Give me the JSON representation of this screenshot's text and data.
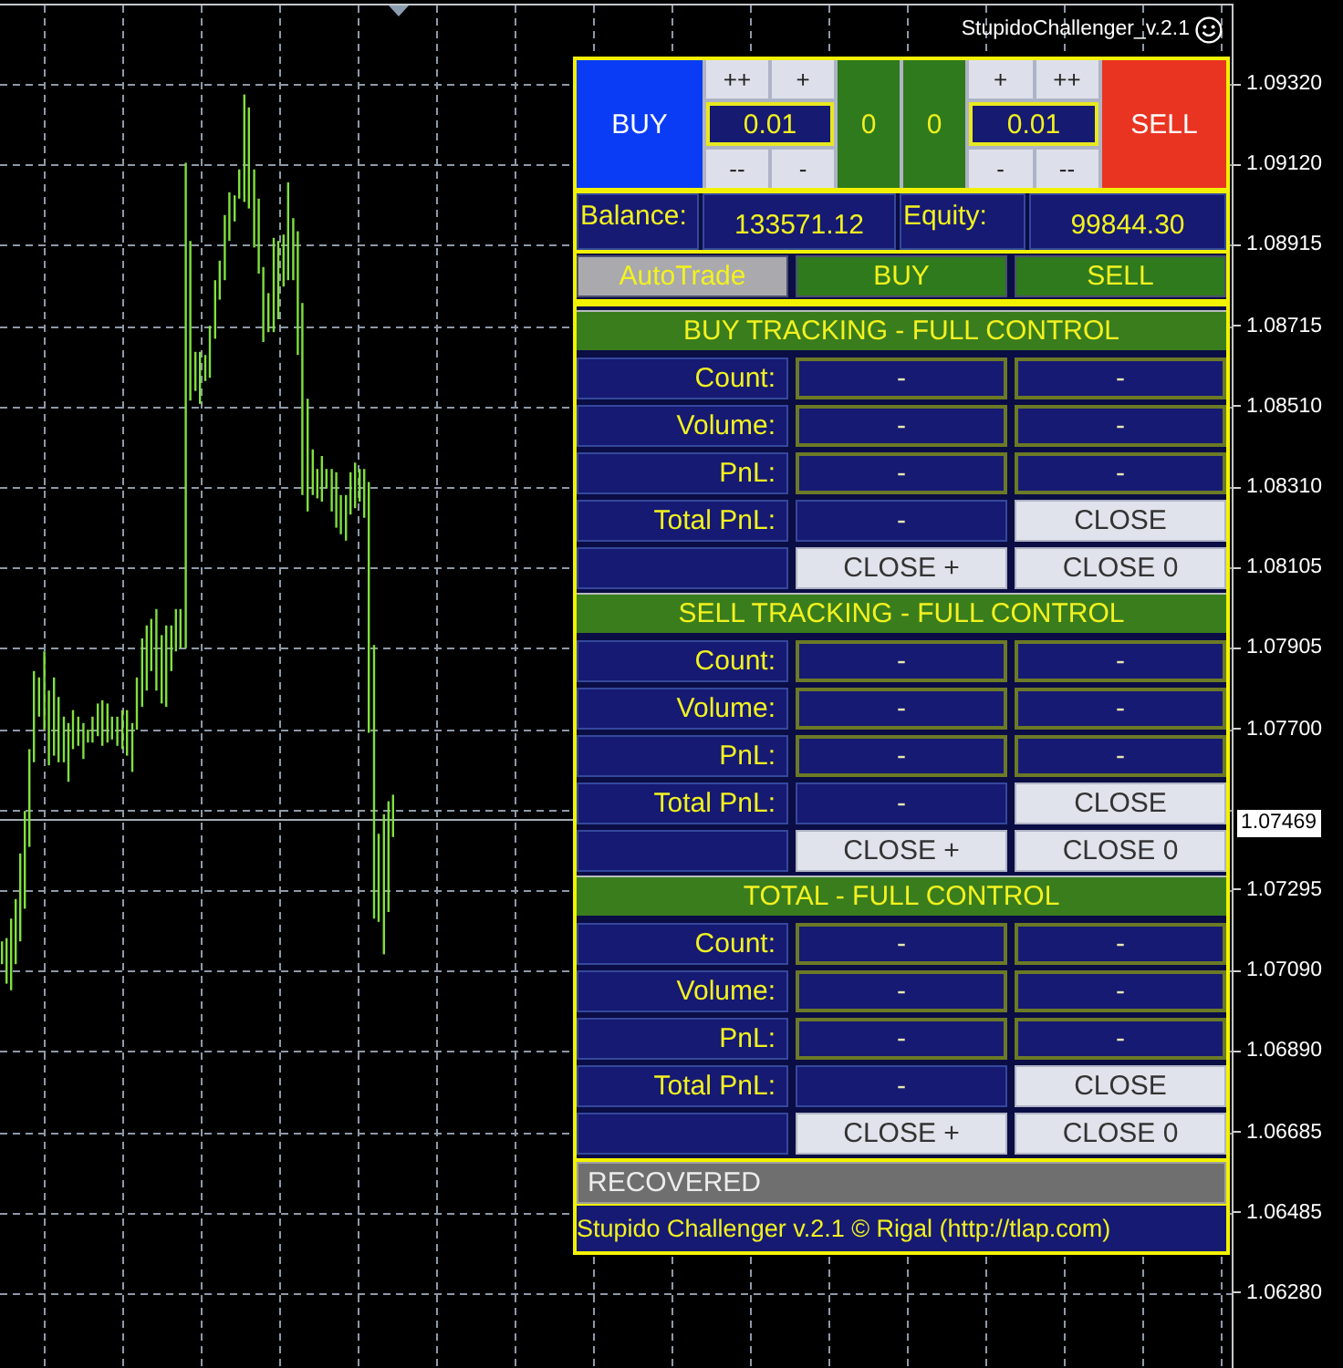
{
  "chart": {
    "title": "StupidoChallenger_v.2.1"
  },
  "price_axis": [
    {
      "kind": "tick",
      "text": "1.09320"
    },
    {
      "kind": "tick",
      "text": "1.09120"
    },
    {
      "kind": "tick",
      "text": "1.08915"
    },
    {
      "kind": "tick",
      "text": "1.08715"
    },
    {
      "kind": "tick",
      "text": "1.08510"
    },
    {
      "kind": "tick",
      "text": "1.08310"
    },
    {
      "kind": "tick",
      "text": "1.08105"
    },
    {
      "kind": "tick",
      "text": "1.07905"
    },
    {
      "kind": "tick",
      "text": "1.07700"
    },
    {
      "kind": "current",
      "text": "1.07469"
    },
    {
      "kind": "tick",
      "text": "1.07295"
    },
    {
      "kind": "tick",
      "text": "1.07090"
    },
    {
      "kind": "tick",
      "text": "1.06890"
    },
    {
      "kind": "tick",
      "text": "1.06685"
    },
    {
      "kind": "tick",
      "text": "1.06485"
    },
    {
      "kind": "tick",
      "text": "1.06280"
    }
  ],
  "panel": {
    "order_bar": {
      "buy_button": "BUY",
      "buy_lot": {
        "increase": [
          "++",
          "+"
        ],
        "value": "0.01",
        "decrease": [
          "--",
          "-"
        ]
      },
      "counters": [
        "0",
        "0"
      ],
      "sell_lot": {
        "increase": [
          "+",
          "++"
        ],
        "value": "0.01",
        "decrease": [
          "-",
          "--"
        ]
      },
      "sell_button": "SELL"
    },
    "account": [
      {
        "label": "Balance:",
        "value": "133571.12"
      },
      {
        "label": "Equity:",
        "value": "99844.30"
      }
    ],
    "toggles": [
      {
        "label": "AutoTrade",
        "on": false
      },
      {
        "label": "BUY",
        "on": true
      },
      {
        "label": "SELL",
        "on": true
      }
    ],
    "sections": [
      {
        "title": "BUY TRACKING - FULL CONTROL",
        "rows": [
          {
            "label": "Count:",
            "cells": [
              {
                "kind": "value",
                "text": "-"
              },
              {
                "kind": "value",
                "text": "-"
              }
            ]
          },
          {
            "label": "Volume:",
            "cells": [
              {
                "kind": "value",
                "text": "-"
              },
              {
                "kind": "value",
                "text": "-"
              }
            ]
          },
          {
            "label": "PnL:",
            "cells": [
              {
                "kind": "value",
                "text": "-"
              },
              {
                "kind": "value",
                "text": "-"
              }
            ]
          },
          {
            "label": "Total PnL:",
            "cells": [
              {
                "kind": "total",
                "text": "-"
              },
              {
                "kind": "button",
                "text": "CLOSE"
              }
            ]
          },
          {
            "cells": [
              {
                "kind": "button",
                "text": "CLOSE +"
              },
              {
                "kind": "button",
                "text": "CLOSE 0"
              }
            ]
          }
        ]
      },
      {
        "title": "SELL TRACKING - FULL CONTROL",
        "rows": [
          {
            "label": "Count:",
            "cells": [
              {
                "kind": "value",
                "text": "-"
              },
              {
                "kind": "value",
                "text": "-"
              }
            ]
          },
          {
            "label": "Volume:",
            "cells": [
              {
                "kind": "value",
                "text": "-"
              },
              {
                "kind": "value",
                "text": "-"
              }
            ]
          },
          {
            "label": "PnL:",
            "cells": [
              {
                "kind": "value",
                "text": "-"
              },
              {
                "kind": "value",
                "text": "-"
              }
            ]
          },
          {
            "label": "Total PnL:",
            "cells": [
              {
                "kind": "total",
                "text": "-"
              },
              {
                "kind": "button",
                "text": "CLOSE"
              }
            ]
          },
          {
            "cells": [
              {
                "kind": "button",
                "text": "CLOSE +"
              },
              {
                "kind": "button",
                "text": "CLOSE 0"
              }
            ]
          }
        ]
      },
      {
        "title": "TOTAL - FULL CONTROL",
        "rows": [
          {
            "label": "Count:",
            "cells": [
              {
                "kind": "value",
                "text": "-"
              },
              {
                "kind": "value",
                "text": "-"
              }
            ]
          },
          {
            "label": "Volume:",
            "cells": [
              {
                "kind": "value",
                "text": "-"
              },
              {
                "kind": "value",
                "text": "-"
              }
            ]
          },
          {
            "label": "PnL:",
            "cells": [
              {
                "kind": "value",
                "text": "-"
              },
              {
                "kind": "value",
                "text": "-"
              }
            ]
          },
          {
            "label": "Total PnL:",
            "cells": [
              {
                "kind": "total",
                "text": "-"
              },
              {
                "kind": "button",
                "text": "CLOSE"
              }
            ]
          },
          {
            "cells": [
              {
                "kind": "button",
                "text": "CLOSE +"
              },
              {
                "kind": "button",
                "text": "CLOSE 0"
              }
            ]
          }
        ]
      }
    ],
    "status": "RECOVERED",
    "footer": "Stupido Challenger v.2.1 © Rigal (http://tlap.com)"
  }
}
